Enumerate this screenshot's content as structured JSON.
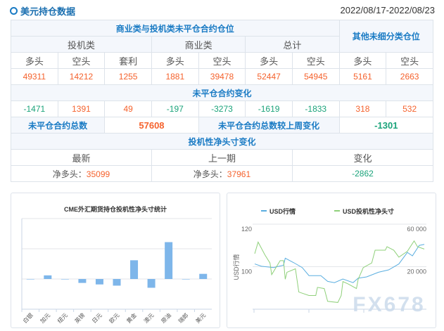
{
  "header": {
    "title": "美元持仓数据",
    "date_range": "2022/08/17-2022/08/23"
  },
  "table": {
    "group_title": "商业类与投机类未平仓合约仓位",
    "other_title": "其他未细分类仓位",
    "sub_groups": [
      "投机类",
      "商业类",
      "总计"
    ],
    "columns": [
      "多头",
      "空头",
      "套利",
      "多头",
      "空头",
      "多头",
      "空头",
      "多头",
      "空头"
    ],
    "positions": [
      "49311",
      "14212",
      "1255",
      "1881",
      "39478",
      "52447",
      "54945",
      "5161",
      "2663"
    ],
    "change_title": "未平仓合约变化",
    "changes": [
      {
        "v": "-1471",
        "c": "g"
      },
      {
        "v": "1391",
        "c": "o"
      },
      {
        "v": "49",
        "c": "o"
      },
      {
        "v": "-197",
        "c": "g"
      },
      {
        "v": "-3273",
        "c": "g"
      },
      {
        "v": "-1619",
        "c": "g"
      },
      {
        "v": "-1833",
        "c": "g"
      },
      {
        "v": "318",
        "c": "o"
      },
      {
        "v": "532",
        "c": "o"
      }
    ],
    "total_label": "未平仓合约总数",
    "total_value": "57608",
    "total_change_label": "未平仓合约总数较上周变化",
    "total_change_value": "-1301",
    "net_title": "投机性净头寸变化",
    "net_headers": [
      "最新",
      "上一期",
      "变化"
    ],
    "net_prefix": "净多头：",
    "latest": "35099",
    "previous": "37961",
    "change": "-2862"
  },
  "chart_data": [
    {
      "type": "bar",
      "title": "CME外汇期货持仓投机性净头寸统计",
      "categories": [
        "白银",
        "加元",
        "纽元",
        "英镑",
        "日元",
        "欧元",
        "黄金",
        "澳元",
        "原油",
        "瑞郎",
        "美元"
      ],
      "values": [
        0,
        0.12,
        0,
        -0.13,
        -0.18,
        -0.22,
        0.62,
        -0.29,
        1.22,
        0,
        0.17
      ],
      "ylim": [
        -1,
        2
      ],
      "grid": true,
      "color": "#7eb6ea"
    },
    {
      "type": "line",
      "legend": [
        "USD行情",
        "USD投机性净头寸"
      ],
      "legend_position": "top",
      "ylabel": "USD行情",
      "left_ticks": [
        "120",
        "100"
      ],
      "right_ticks": [
        "60 000",
        "20 000"
      ],
      "ylim_left": [
        80,
        120
      ],
      "ylim_right": [
        -20000,
        60000
      ],
      "series": [
        {
          "name": "USD行情",
          "axis": "left",
          "color": "#5aaee0",
          "points": [
            [
              0,
              101.3
            ],
            [
              4,
              100.2
            ],
            [
              11,
              99.6
            ],
            [
              17,
              100.7
            ],
            [
              18,
              104.0
            ],
            [
              23,
              101.9
            ],
            [
              28,
              99.6
            ],
            [
              32,
              95.8
            ],
            [
              39,
              95.8
            ],
            [
              43,
              93.1
            ],
            [
              47,
              92.5
            ],
            [
              52,
              94.2
            ],
            [
              58,
              92.5
            ],
            [
              61,
              94.6
            ],
            [
              66,
              95.2
            ],
            [
              73,
              97.4
            ],
            [
              79,
              98.5
            ],
            [
              85,
              101.3
            ],
            [
              90,
              106.7
            ],
            [
              93,
              105.1
            ],
            [
              97,
              110.0
            ],
            [
              100,
              110.5
            ]
          ]
        },
        {
          "name": "USD投机性净头寸",
          "axis": "right",
          "color": "#8fd07a",
          "points": [
            [
              0,
              32240
            ],
            [
              2,
              43170
            ],
            [
              6,
              31140
            ],
            [
              9,
              23490
            ],
            [
              10,
              12560
            ],
            [
              15,
              25680
            ],
            [
              17,
              25680
            ],
            [
              18,
              8190
            ],
            [
              19,
              14750
            ],
            [
              24,
              18030
            ],
            [
              26,
              -3830
            ],
            [
              32,
              -7110
            ],
            [
              36,
              -7110
            ],
            [
              37,
              540
            ],
            [
              41,
              -550
            ],
            [
              43,
              -12570
            ],
            [
              49,
              -13670
            ],
            [
              51,
              -7110
            ],
            [
              52,
              6000
            ],
            [
              55,
              3820
            ],
            [
              60,
              -550
            ],
            [
              61,
              8190
            ],
            [
              64,
              19120
            ],
            [
              69,
              23490
            ],
            [
              71,
              35520
            ],
            [
              77,
              35520
            ],
            [
              78,
              38800
            ],
            [
              82,
              35520
            ],
            [
              85,
              28960
            ],
            [
              90,
              34420
            ],
            [
              94,
              44260
            ],
            [
              96,
              38800
            ],
            [
              100,
              36610
            ]
          ]
        }
      ],
      "watermark": "FX678"
    }
  ]
}
